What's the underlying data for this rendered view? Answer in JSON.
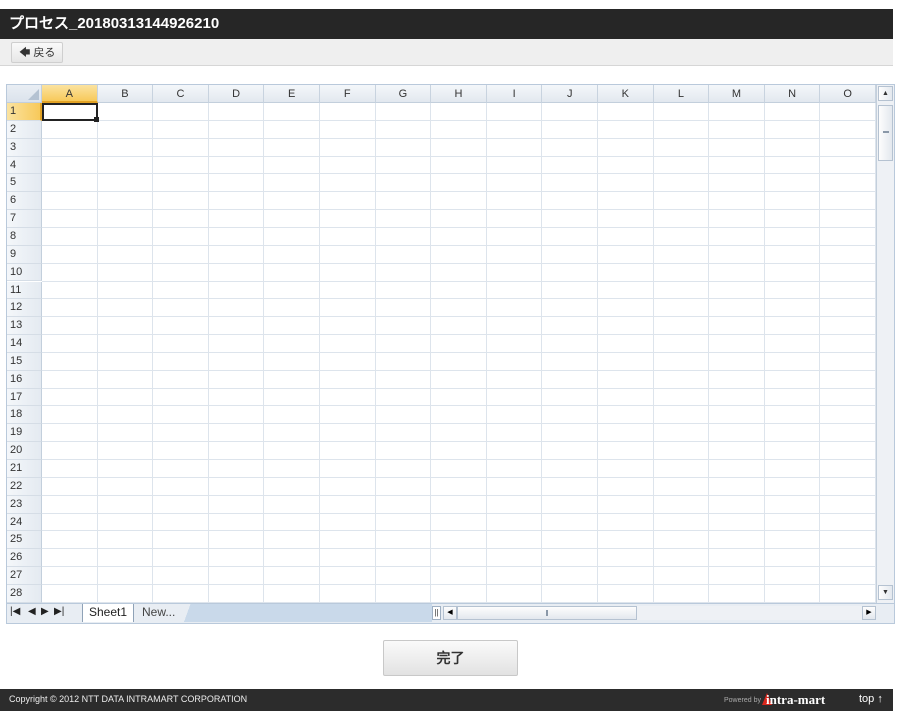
{
  "window": {
    "title": "プロセス_20180313144926210"
  },
  "toolbar": {
    "back_label": "戻る",
    "back_icon": "arrow-left-icon"
  },
  "sheet": {
    "columns": [
      "A",
      "B",
      "C",
      "D",
      "E",
      "F",
      "G",
      "H",
      "I",
      "J",
      "K",
      "L",
      "M",
      "N",
      "O"
    ],
    "rows": [
      "1",
      "2",
      "3",
      "4",
      "5",
      "6",
      "7",
      "8",
      "9",
      "10",
      "11",
      "12",
      "13",
      "14",
      "15",
      "16",
      "17",
      "18",
      "19",
      "20",
      "21",
      "22",
      "23",
      "24",
      "25",
      "26",
      "27",
      "28"
    ],
    "selected_cell": "A1",
    "active_tab": "Sheet1",
    "new_tab": "New...",
    "accent_color": "#f7c95a"
  },
  "actions": {
    "done_label": "完了"
  },
  "footer": {
    "copyright": "Copyright © 2012 NTT DATA INTRAMART CORPORATION",
    "powered_by": "Powered by",
    "logo_text": "intra-mart",
    "top_link": "top ↑"
  }
}
